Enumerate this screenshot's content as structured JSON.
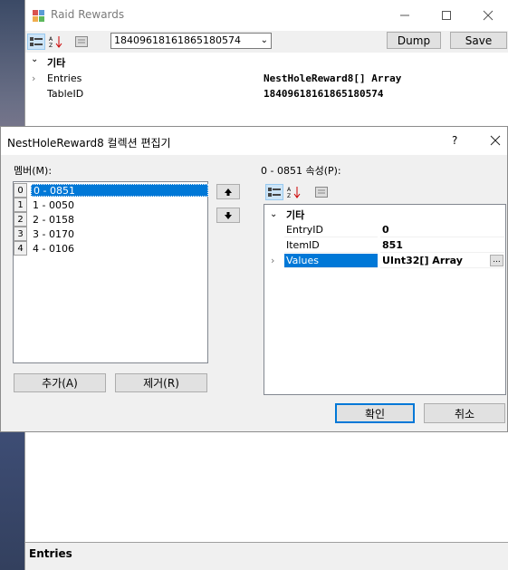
{
  "back_window": {
    "title": "Raid Rewards",
    "seed_combo_value": "18409618161865180574",
    "dump_label": "Dump",
    "save_label": "Save",
    "category": "기타",
    "props": [
      {
        "name": "Entries",
        "value": "NestHoleReward8[] Array"
      },
      {
        "name": "TableID",
        "value": "18409618161865180574"
      }
    ],
    "description_title": "Entries"
  },
  "dialog": {
    "title": "NestHoleReward8 컬렉션 편집기",
    "help_label": "?",
    "members_label": "멤버(M):",
    "properties_label": "0 - 0851 속성(P):",
    "members": [
      {
        "index": "0",
        "text": "0 - 0851"
      },
      {
        "index": "1",
        "text": "1 - 0050"
      },
      {
        "index": "2",
        "text": "2 - 0158"
      },
      {
        "index": "3",
        "text": "3 - 0170"
      },
      {
        "index": "4",
        "text": "4 - 0106"
      }
    ],
    "add_label": "추가(A)",
    "remove_label": "제거(R)",
    "category": "기타",
    "props": [
      {
        "name": "EntryID",
        "value": "0"
      },
      {
        "name": "ItemID",
        "value": "851"
      },
      {
        "name": "Values",
        "value": "UInt32[] Array"
      }
    ],
    "ellipsis_label": "...",
    "ok_label": "확인",
    "cancel_label": "취소"
  }
}
